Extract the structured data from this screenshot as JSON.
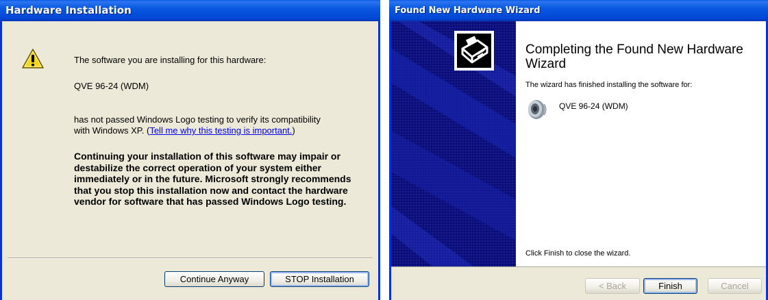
{
  "hardware_installation": {
    "title": "Hardware Installation",
    "intro": "The software you are installing for this hardware:",
    "device_name": "QVE 96-24 (WDM)",
    "logo_text": "has not passed Windows Logo testing to verify its compatibility",
    "logo_text2": "with Windows XP.",
    "link_text": "Tell me why this testing is important.",
    "warning": "Continuing your installation of this software may impair or destabilize the correct operation of your system either immediately or in the future. Microsoft strongly recommends that you stop this installation now and contact the hardware vendor for software that has passed Windows Logo testing.",
    "continue_label": "Continue Anyway",
    "stop_label": "STOP Installation"
  },
  "wizard": {
    "title": "Found New Hardware Wizard",
    "heading": "Completing the Found New Hardware Wizard",
    "finished_text": "The wizard has finished installing the software for:",
    "device_name": "QVE 96-24 (WDM)",
    "footer_text": "Click Finish to close the wizard.",
    "back_label": "< Back",
    "finish_label": "Finish",
    "cancel_label": "Cancel"
  },
  "colors": {
    "titlebar": "#0054e3",
    "dialog_bg": "#ece9d8",
    "link": "#0000ee",
    "wizard_panel": "#0d0f7a"
  },
  "icons": [
    "warning-icon",
    "hardware-card-icon",
    "speaker-icon"
  ]
}
